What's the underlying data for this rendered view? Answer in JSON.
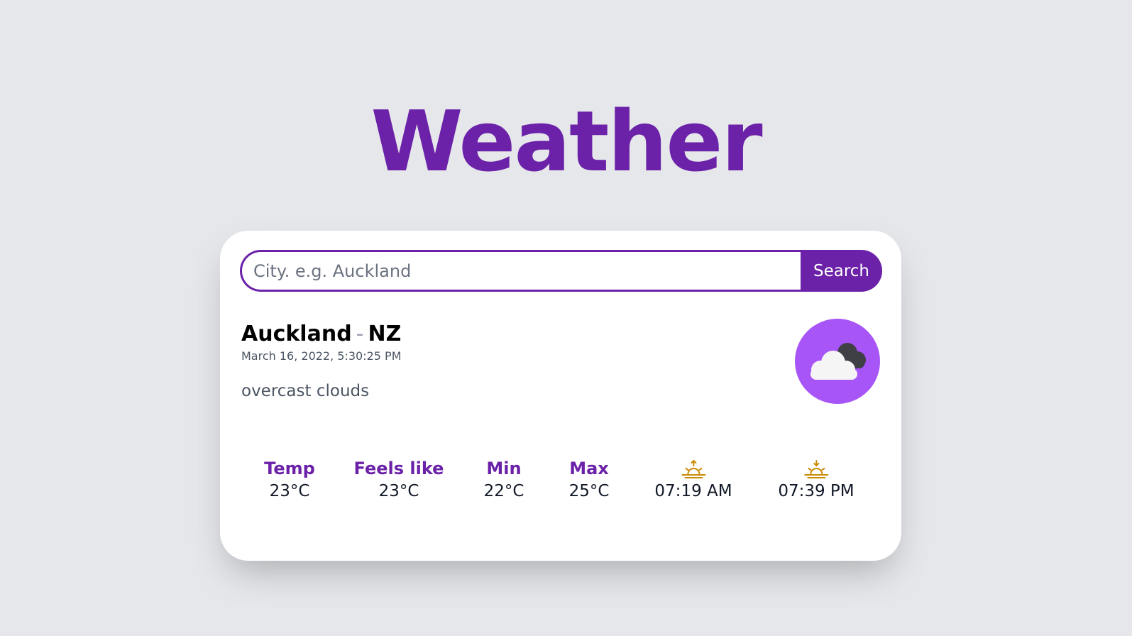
{
  "header": {
    "title": "Weather"
  },
  "search": {
    "placeholder": "City. e.g. Auckland",
    "value": "",
    "button_label": "Search"
  },
  "location": {
    "city": "Auckland",
    "separator": "-",
    "country": "NZ",
    "datetime": "March 16, 2022, 5:30:25 PM",
    "description": "overcast clouds",
    "weather_icon": "overcast-clouds-icon"
  },
  "stats": {
    "temp": {
      "label": "Temp",
      "value": "23°C"
    },
    "feels_like": {
      "label": "Feels like",
      "value": "23°C"
    },
    "min": {
      "label": "Min",
      "value": "22°C"
    },
    "max": {
      "label": "Max",
      "value": "25°C"
    },
    "sunrise": {
      "icon": "sunrise-icon",
      "value": "07:19 AM"
    },
    "sunset": {
      "icon": "sunset-icon",
      "value": "07:39 PM"
    }
  },
  "colors": {
    "accent": "#6b21a8",
    "icon_bg": "#a855f7",
    "sun_icon": "#ca8a04",
    "background": "#e5e7eb"
  }
}
